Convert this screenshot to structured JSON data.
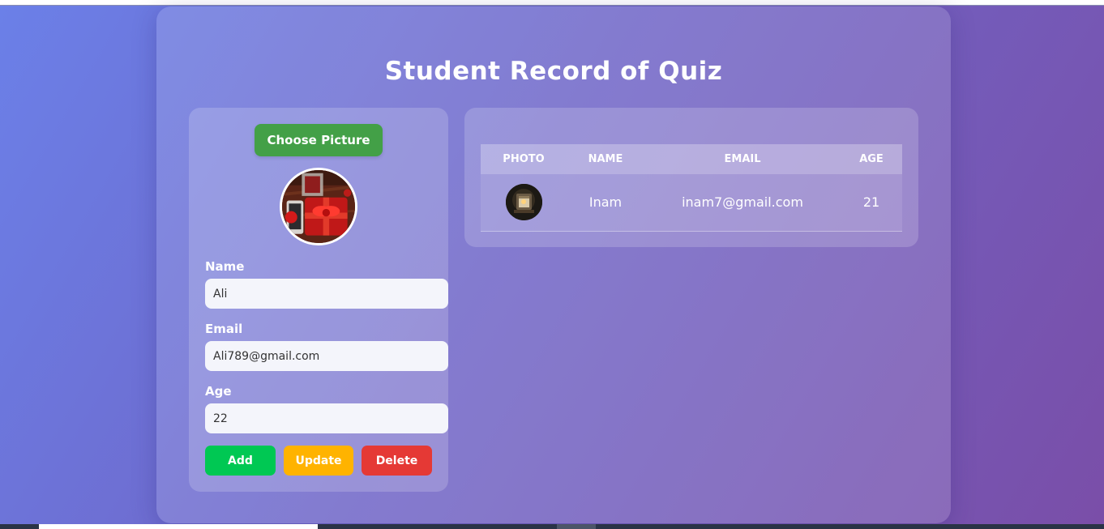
{
  "app": {
    "title": "Student Record of Quiz"
  },
  "form": {
    "choose_picture_label": "Choose Picture",
    "avatar_icon": "gift-photo",
    "fields": {
      "name": {
        "label": "Name",
        "value": "Ali"
      },
      "email": {
        "label": "Email",
        "value": "Ali789@gmail.com"
      },
      "age": {
        "label": "Age",
        "value": "22"
      }
    },
    "buttons": {
      "add": "Add",
      "update": "Update",
      "delete": "Delete"
    }
  },
  "table": {
    "headers": [
      "PHOTO",
      "NAME",
      "EMAIL",
      "AGE"
    ],
    "rows": [
      {
        "photo_icon": "lantern-photo",
        "name": "Inam",
        "email": "inam7@gmail.com",
        "age": "21"
      }
    ]
  },
  "colors": {
    "add": "#00c853",
    "update": "#ffb300",
    "delete": "#e53935",
    "choose": "#43a047"
  }
}
